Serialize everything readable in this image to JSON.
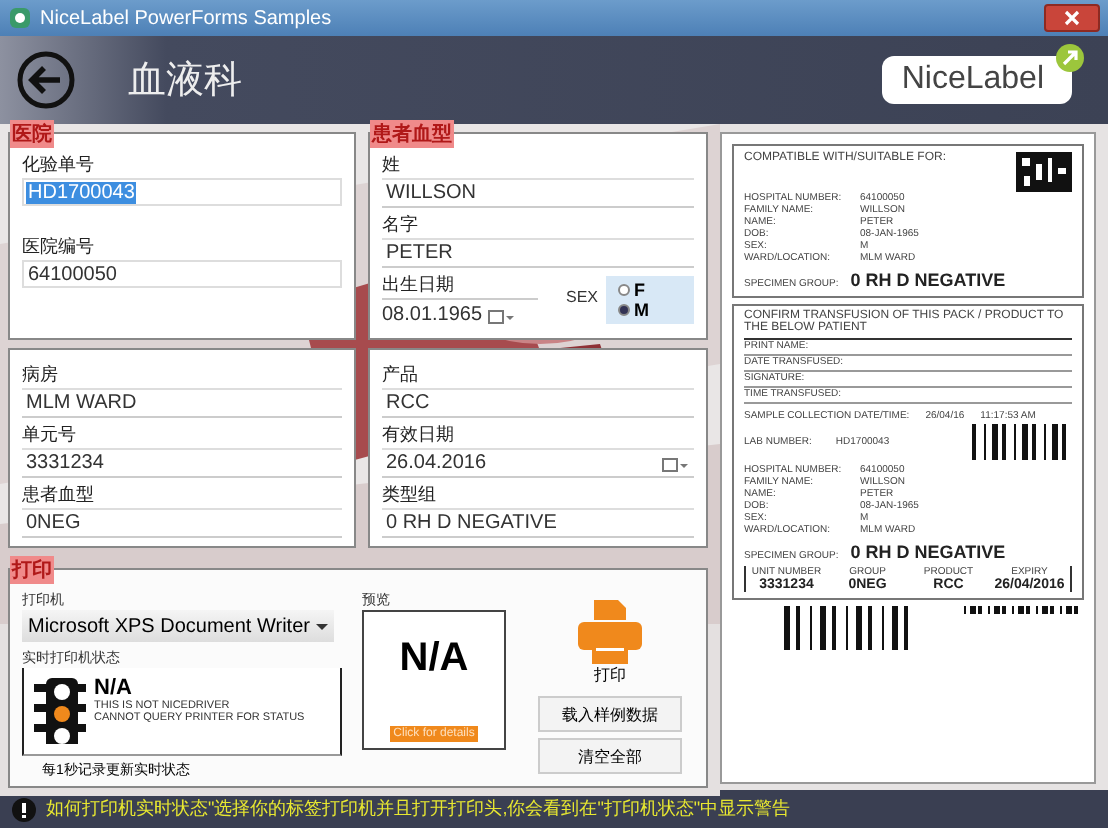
{
  "window": {
    "title": "NiceLabel PowerForms Samples"
  },
  "header": {
    "title": "血液科",
    "logo": "NiceLabel"
  },
  "hospital": {
    "legend": "医院",
    "fields": [
      {
        "label": "化验单号",
        "value": "HD1700043",
        "selected": true
      },
      {
        "label": "医院编号",
        "value": "64100050",
        "selected": false
      }
    ]
  },
  "patient": {
    "legend": "患者血型",
    "fields": [
      {
        "label": "姓",
        "value": "WILLSON"
      },
      {
        "label": "名字",
        "value": "PETER"
      }
    ],
    "dob": {
      "label": "出生日期",
      "value": "08.01.1965"
    },
    "sex": {
      "label": "SEX",
      "options": [
        {
          "label": "F",
          "selected": false
        },
        {
          "label": "M",
          "selected": true
        }
      ]
    }
  },
  "ward": {
    "fields": [
      {
        "label": "病房",
        "value": "MLM WARD"
      },
      {
        "label": "单元号",
        "value": "3331234"
      },
      {
        "label": "患者血型",
        "value": "0NEG"
      }
    ]
  },
  "product": {
    "fields": [
      {
        "label": "产品",
        "value": "RCC",
        "kind": "text"
      },
      {
        "label": "有效日期",
        "value": "26.04.2016",
        "kind": "date"
      },
      {
        "label": "类型组",
        "value": "0 RH D NEGATIVE",
        "kind": "text"
      }
    ]
  },
  "print": {
    "legend": "打印",
    "printer_label": "打印机",
    "printer": "Microsoft XPS Document Writer",
    "status_label": "实时打印机状态",
    "status": "N/A",
    "status_message": [
      "THIS IS NOT NICEDRIVER",
      "CANNOT QUERY PRINTER FOR STATUS"
    ],
    "status_note": "每1秒记录更新实时状态",
    "preview_label": "预览",
    "preview": "N/A",
    "details_link": "Click for details",
    "print_button": "打印",
    "buttons": [
      "载入样例数据",
      "清空全部"
    ]
  },
  "label_preview": {
    "top": {
      "heading": "COMPATIBLE WITH/SUITABLE FOR:",
      "rows": [
        [
          "HOSPITAL NUMBER:",
          "64100050"
        ],
        [
          "FAMILY NAME:",
          "WILLSON"
        ],
        [
          "NAME:",
          "PETER"
        ],
        [
          "DOB:",
          "08-JAN-1965"
        ],
        [
          "SEX:",
          "M"
        ],
        [
          "WARD/LOCATION:",
          "MLM WARD"
        ]
      ],
      "group_label": "SPECIMEN GROUP:",
      "group": "0 RH D NEGATIVE"
    },
    "confirm": {
      "heading": "CONFIRM TRANSFUSION OF THIS PACK / PRODUCT TO THE BELOW PATIENT",
      "lines": [
        "PRINT NAME:",
        "DATE TRANSFUSED:",
        "SIGNATURE:",
        "TIME TRANSFUSED:"
      ]
    },
    "sample": {
      "label": "SAMPLE COLLECTION DATE/TIME:",
      "date": "26/04/16",
      "time": "11:17:53 AM",
      "lab_label": "LAB NUMBER:",
      "lab": "HD1700043",
      "rows": [
        [
          "HOSPITAL NUMBER:",
          "64100050"
        ],
        [
          "FAMILY NAME:",
          "WILLSON"
        ],
        [
          "NAME:",
          "PETER"
        ],
        [
          "DOB:",
          "08-JAN-1965"
        ],
        [
          "SEX:",
          "M"
        ],
        [
          "WARD/LOCATION:",
          "MLM WARD"
        ]
      ],
      "group_label": "SPECIMEN GROUP:",
      "group": "0 RH D NEGATIVE"
    },
    "cells": [
      {
        "label": "UNIT NUMBER",
        "value": "3331234"
      },
      {
        "label": "GROUP",
        "value": "0NEG"
      },
      {
        "label": "PRODUCT",
        "value": "RCC"
      },
      {
        "label": "EXPIRY",
        "value": "26/04/2016"
      }
    ]
  },
  "footer": {
    "message": "如何打印机实时状态\"选择你的标签打印机并且打开打印头,你会看到在\"打印机状态\"中显示警告"
  }
}
